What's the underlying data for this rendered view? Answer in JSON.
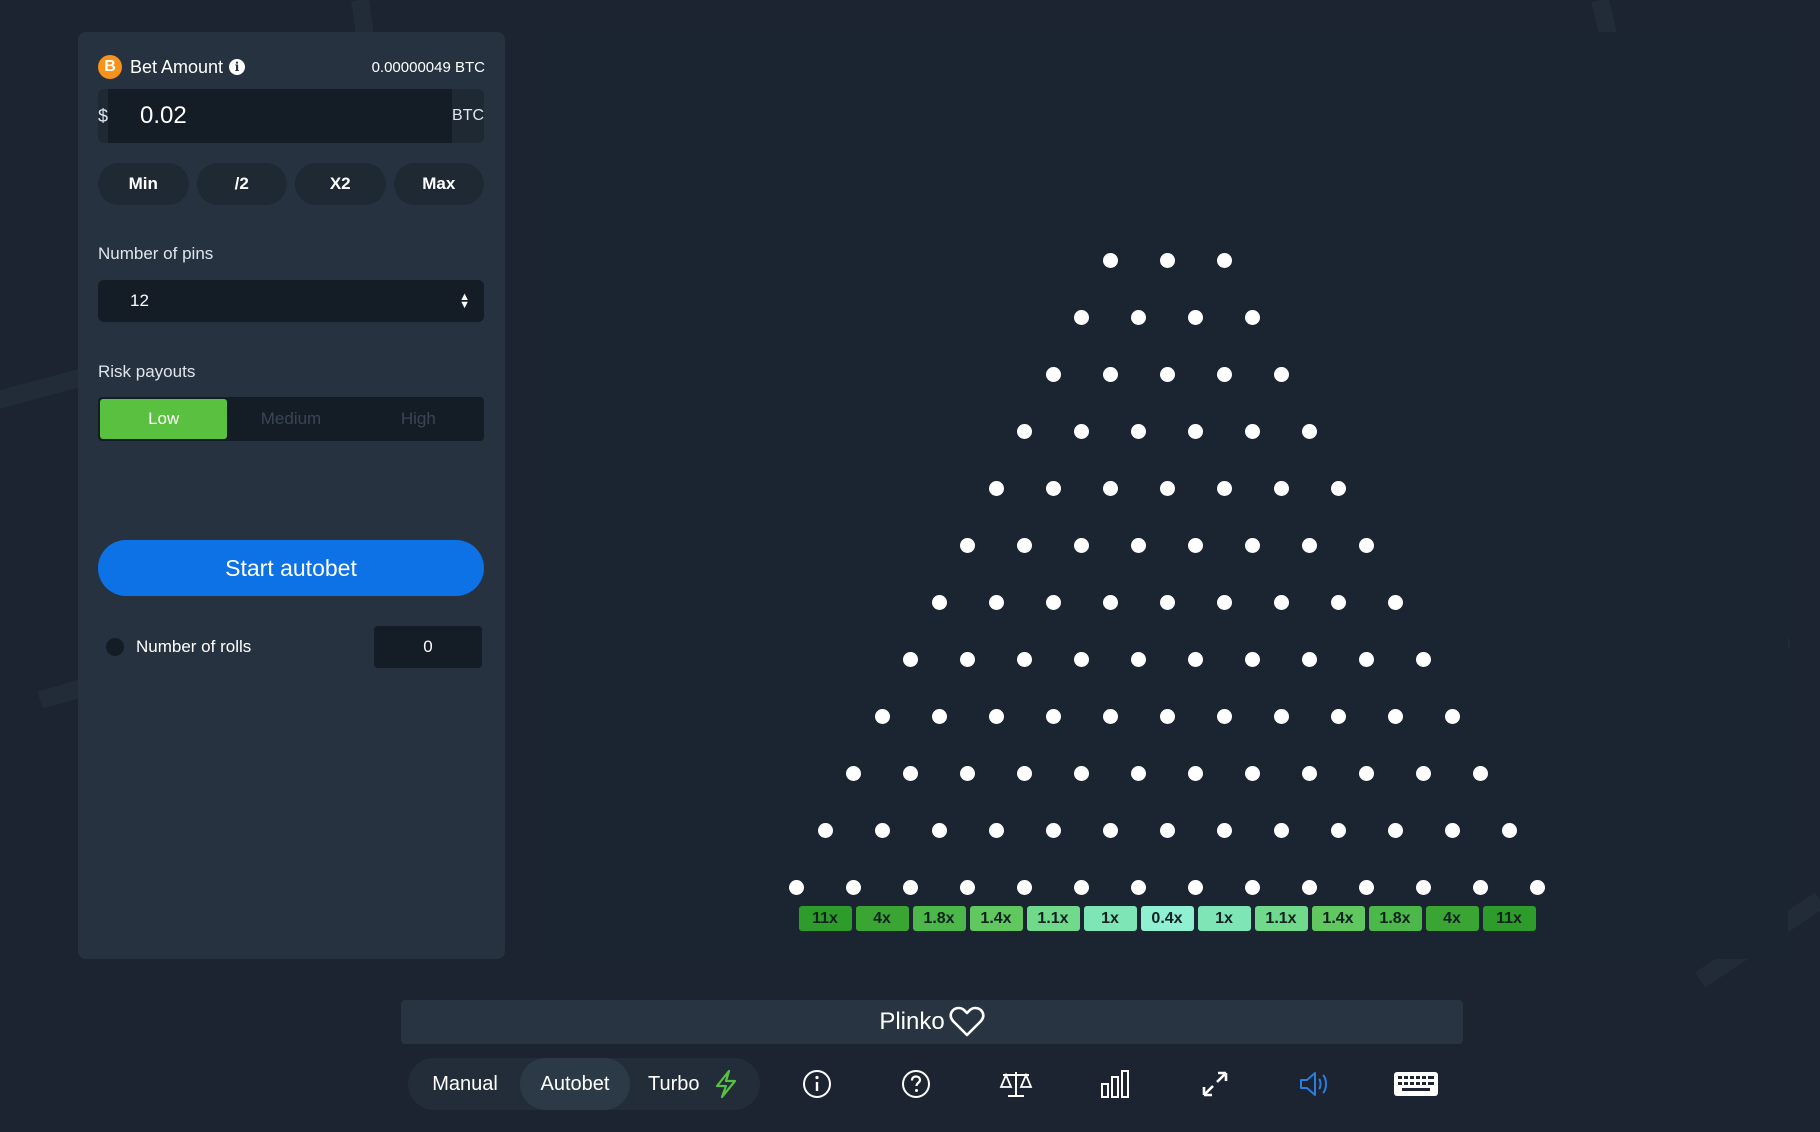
{
  "bet": {
    "currency_icon": "bitcoin-icon",
    "title": "Bet Amount",
    "info_icon": "info-icon",
    "balance": "0.00000049 BTC",
    "prefix": "$",
    "amount": "0.02",
    "suffix": "BTC",
    "quick": [
      "Min",
      "/2",
      "X2",
      "Max"
    ]
  },
  "pins": {
    "label": "Number of pins",
    "value": "12"
  },
  "risk": {
    "label": "Risk payouts",
    "options": [
      "Low",
      "Medium",
      "High"
    ],
    "selected": "Low"
  },
  "start_label": "Start autobet",
  "rolls": {
    "label": "Number of rolls",
    "value": "0"
  },
  "board": {
    "peg_rows": 12,
    "first_row_pegs": 3,
    "multipliers": [
      "11x",
      "4x",
      "1.8x",
      "1.4x",
      "1.1x",
      "1x",
      "0.4x",
      "1x",
      "1.1x",
      "1.4x",
      "1.8x",
      "4x",
      "11x"
    ],
    "multiplier_colors": [
      "#2e9c2a",
      "#3aa532",
      "#4cb84a",
      "#60c85e",
      "#70d98c",
      "#7ee6b6",
      "#8ff0d2",
      "#7ee6b6",
      "#70d98c",
      "#60c85e",
      "#4cb84a",
      "#3aa532",
      "#2e9c2a"
    ]
  },
  "game": {
    "title": "Plinko",
    "favorite_icon": "heart-icon"
  },
  "toolbar": {
    "modes": [
      "Manual",
      "Autobet"
    ],
    "active_mode": "Autobet",
    "turbo_label": "Turbo",
    "icons": [
      "lightning-icon",
      "info-icon",
      "help-icon",
      "fairness-scale-icon",
      "stats-icon",
      "fullscreen-icon",
      "sound-icon",
      "keyboard-icon"
    ]
  },
  "colors": {
    "accent_green": "#5ac140",
    "accent_blue": "#0c72e6",
    "sound_blue": "#2a7de1",
    "turbo_green": "#5ac140"
  }
}
